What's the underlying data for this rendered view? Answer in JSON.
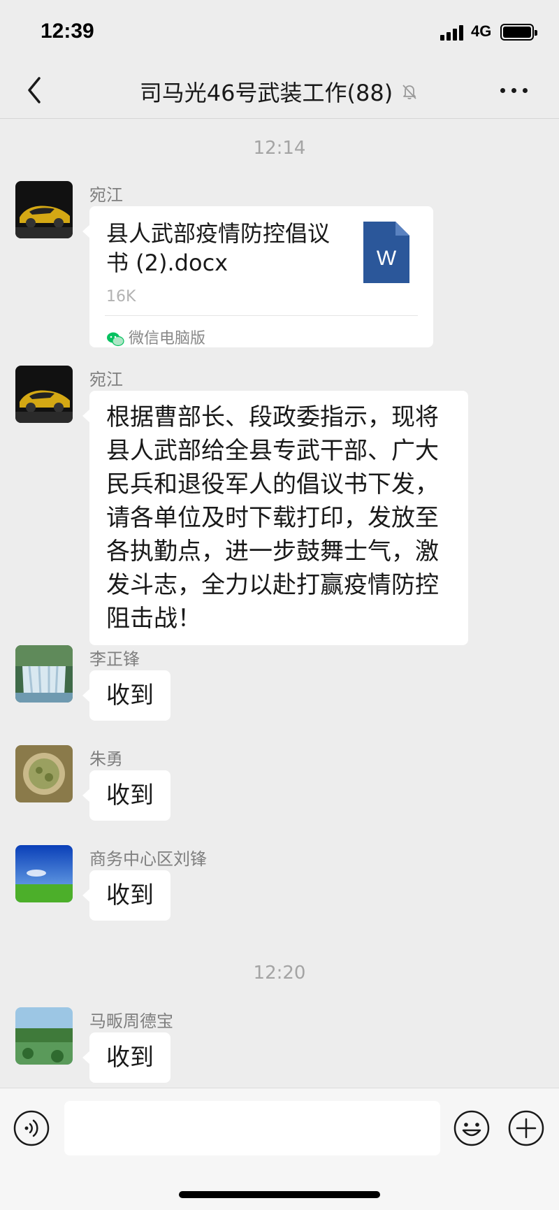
{
  "status_bar": {
    "time": "12:39",
    "network": "4G"
  },
  "nav": {
    "title": "司马光46号武装工作(88)"
  },
  "messages": [
    {
      "type": "time",
      "text": "12:14"
    },
    {
      "sender": "宛江",
      "type": "file",
      "file_name": "县人武部疫情防控倡议书 (2).docx",
      "file_size": "16K",
      "source": "微信电脑版",
      "icon": "word-file-icon"
    },
    {
      "sender": "宛江",
      "type": "text",
      "text": "根据曹部长、段政委指示，现将县人武部给全县专武干部、广大民兵和退役军人的倡议书下发，请各单位及时下载打印，发放至各执勤点，进一步鼓舞士气，激发斗志，全力以赴打赢疫情防控阻击战！"
    },
    {
      "sender": "李正锋",
      "type": "text",
      "text": "收到"
    },
    {
      "sender": "朱勇",
      "type": "text",
      "text": "收到"
    },
    {
      "sender": "商务中心区刘锋",
      "type": "text",
      "text": "收到"
    },
    {
      "type": "time",
      "text": "12:20"
    },
    {
      "sender": "马畈周德宝",
      "type": "text",
      "text": "收到"
    }
  ],
  "input": {
    "placeholder": ""
  },
  "colors": {
    "background": "#ededed",
    "bubble": "#ffffff",
    "word_blue": "#2b579a",
    "wechat_green": "#07c160"
  }
}
